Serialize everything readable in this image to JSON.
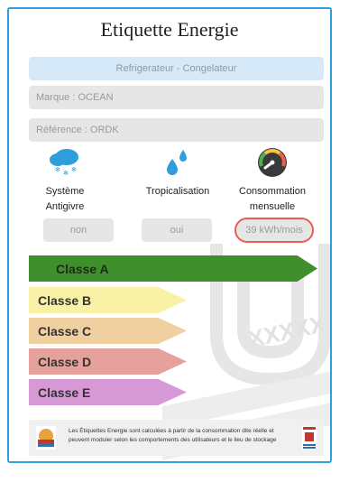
{
  "title": "Etiquette Energie",
  "category": "Refrigerateur - Congelateur",
  "brand_field": "Marque : OCEAN",
  "reference_field": "Référence : ORDK",
  "features": [
    {
      "label": "Système Antigivre",
      "value": "non",
      "icon": "snow-cloud-icon"
    },
    {
      "label": "Tropicalisation",
      "value": "oui",
      "icon": "water-drops-icon"
    },
    {
      "label": "Consommation mensuelle",
      "value": "39 kWh/mois",
      "icon": "gauge-icon"
    }
  ],
  "energy_classes": [
    {
      "label": "Classe A",
      "color": "#3f8f2c",
      "selected": true
    },
    {
      "label": "Classe B",
      "color": "#f8f1a6"
    },
    {
      "label": "Classe C",
      "color": "#f0cfa1"
    },
    {
      "label": "Classe D",
      "color": "#e7a19c"
    },
    {
      "label": "Classe E",
      "color": "#d699d6"
    }
  ],
  "footer_text": "Les Étiquettes Energie sont calculées à partir de la consommation dite réelle et peuvent moduler selon les comportements des utilisateurs et le lieu de stockage",
  "colors": {
    "border": "#2f9fdb",
    "highlight": "#e8604c",
    "category_bg": "#d6e9f8"
  }
}
